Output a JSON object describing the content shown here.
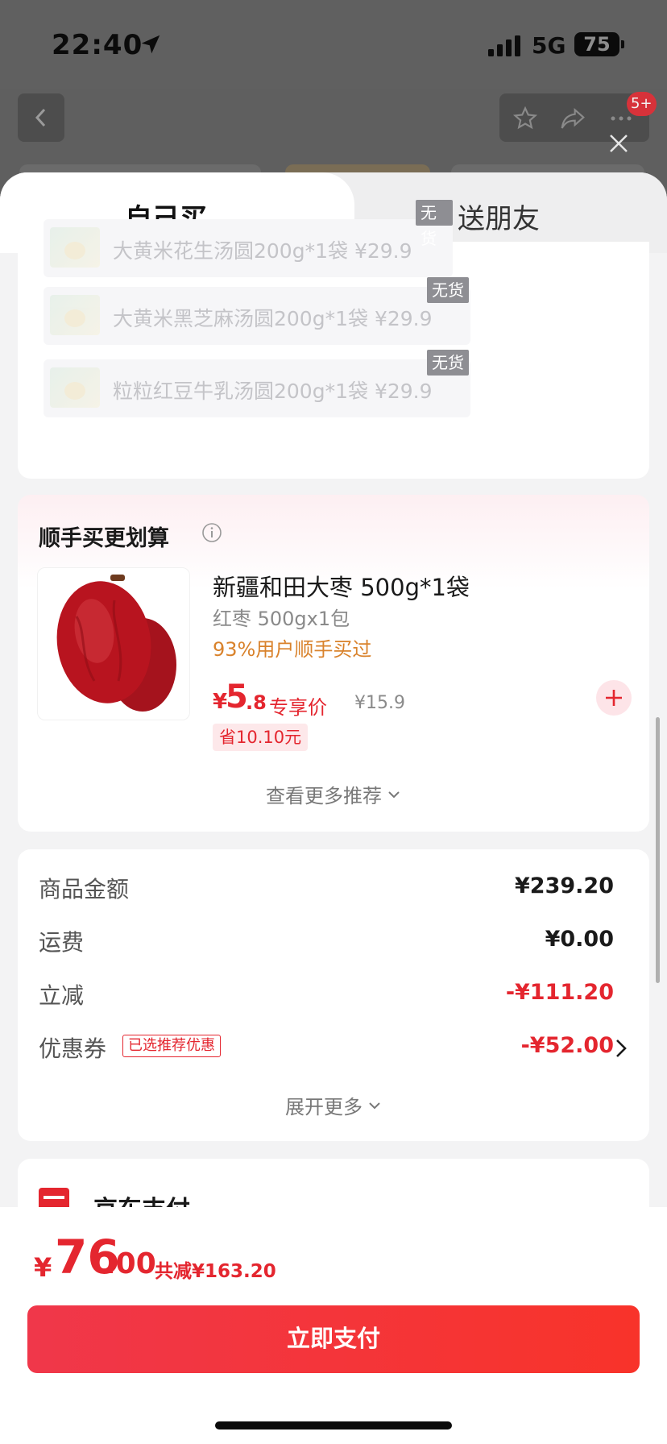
{
  "status_bar": {
    "time": "22:40",
    "network": "5G",
    "battery": "75"
  },
  "top_nav": {
    "badge": "5+"
  },
  "tabs": {
    "self_buy": "自己买",
    "gift": "送朋友"
  },
  "out_of_stock": {
    "items": [
      {
        "name": "大黄米花生汤圆200g*1袋",
        "price": "¥29.9",
        "tag": "无货"
      },
      {
        "name": "大黄米黑芝麻汤圆200g*1袋",
        "price": "¥29.9",
        "tag": "无货"
      },
      {
        "name": "粒粒红豆牛乳汤圆200g*1袋",
        "price": "¥29.9",
        "tag": "无货"
      }
    ]
  },
  "recommend": {
    "title": "顺手买更划算",
    "product": {
      "name": "新疆和田大枣 500g*1袋",
      "spec": "红枣 500gx1包",
      "stat": "93%用户顺手买过",
      "price_symbol": "¥",
      "price_int": "5",
      "price_dec": ".8",
      "price_label": "专享价",
      "orig_price": "¥15.9",
      "save": "省10.10元"
    },
    "more_label": "查看更多推荐"
  },
  "summary": {
    "rows": [
      {
        "label": "商品金额",
        "value": "¥239.20"
      },
      {
        "label": "运费",
        "value": "¥0.00"
      },
      {
        "label": "立减",
        "value": "-¥111.20"
      },
      {
        "label": "优惠券",
        "value": "-¥52.00",
        "tag": "已选推荐优惠"
      }
    ],
    "expand_label": "展开更多"
  },
  "payment": {
    "title": "京东支付"
  },
  "bottom": {
    "total_symbol": "¥",
    "total_int": "76",
    "total_dec": ".00",
    "total_saved": "共减¥163.20",
    "pay_button": "立即支付"
  },
  "colors": {
    "accent": "#e4262f",
    "promo": "#d9822b"
  }
}
